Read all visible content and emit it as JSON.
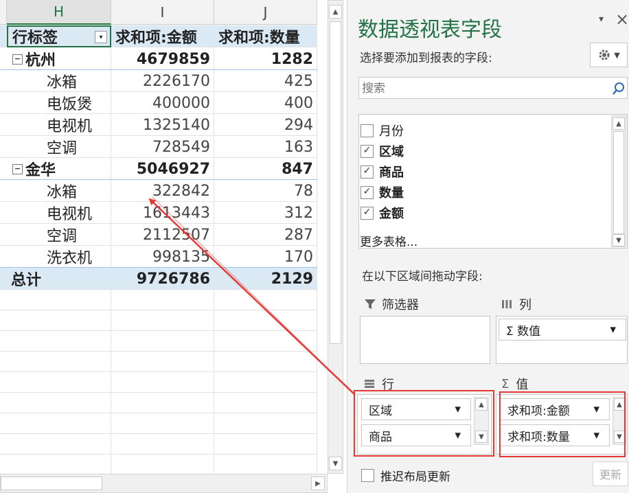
{
  "sheet": {
    "columns": [
      "H",
      "I",
      "J"
    ],
    "header": [
      "行标签",
      "求和项:金额",
      "求和项:数量"
    ],
    "rows": [
      {
        "label": "杭州",
        "amount": "4679859",
        "qty": "1282",
        "group": true
      },
      {
        "label": "冰箱",
        "amount": "2226170",
        "qty": "425"
      },
      {
        "label": "电饭煲",
        "amount": "400000",
        "qty": "400"
      },
      {
        "label": "电视机",
        "amount": "1325140",
        "qty": "294"
      },
      {
        "label": "空调",
        "amount": "728549",
        "qty": "163"
      },
      {
        "label": "金华",
        "amount": "5046927",
        "qty": "847",
        "group": true
      },
      {
        "label": "冰箱",
        "amount": "322842",
        "qty": "78"
      },
      {
        "label": "电视机",
        "amount": "1613443",
        "qty": "312"
      },
      {
        "label": "空调",
        "amount": "2112507",
        "qty": "287"
      },
      {
        "label": "洗衣机",
        "amount": "998135",
        "qty": "170"
      }
    ],
    "total": {
      "label": "总计",
      "amount": "9726786",
      "qty": "2129"
    },
    "collapse_glyph": "−",
    "filter_glyph": "▾"
  },
  "pane": {
    "title": "数据透视表字段",
    "close_glyph": "×",
    "menu_glyph": "▾",
    "choose_label": "选择要添加到报表的字段:",
    "search_placeholder": "搜索",
    "fields": [
      {
        "name": "月份",
        "checked": false
      },
      {
        "name": "区域",
        "checked": true
      },
      {
        "name": "商品",
        "checked": true
      },
      {
        "name": "数量",
        "checked": true
      },
      {
        "name": "金额",
        "checked": true
      }
    ],
    "more_tables": "更多表格...",
    "drag_label": "在以下区域间拖动字段:",
    "zones": {
      "filter": {
        "label": "筛选器"
      },
      "columns": {
        "label": "列",
        "items": [
          "Σ 数值"
        ]
      },
      "rows": {
        "label": "行",
        "items": [
          "区域",
          "商品"
        ]
      },
      "values": {
        "label": "值",
        "items": [
          "求和项:金额",
          "求和项:数量"
        ]
      }
    },
    "defer_label": "推迟布局更新",
    "update_button": "更新"
  },
  "colors": {
    "accent": "#217346",
    "highlight": "#e53935",
    "pivot_header": "#dbe9f5"
  }
}
